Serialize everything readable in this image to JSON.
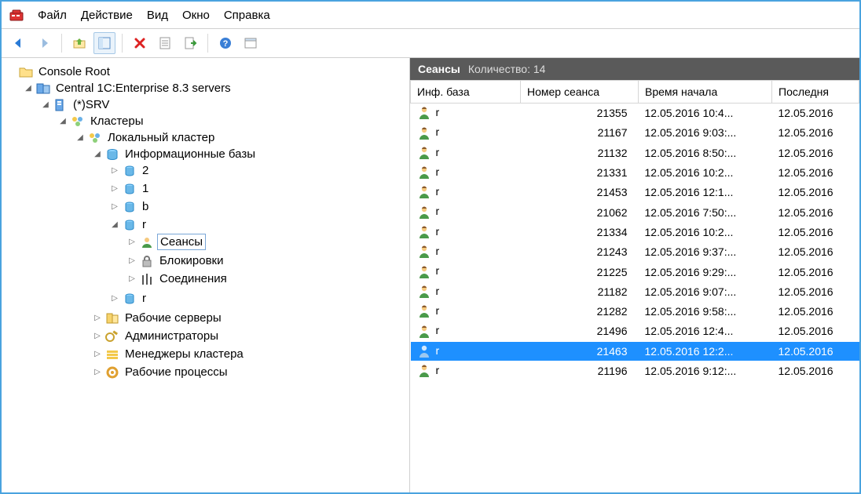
{
  "menu": {
    "items": [
      "Файл",
      "Действие",
      "Вид",
      "Окно",
      "Справка"
    ]
  },
  "tree": {
    "root": "Console Root",
    "servers": "Central 1C:Enterprise 8.3 servers",
    "srv": "(*)SRV",
    "clusters": "Кластеры",
    "local_cluster": "Локальный кластер",
    "infobases": "Информационные базы",
    "ib": [
      "2",
      "1",
      "b",
      "r",
      "r"
    ],
    "ib_r_children": {
      "sessions": "Сеансы",
      "locks": "Блокировки",
      "connections": "Соединения"
    },
    "work_servers": "Рабочие серверы",
    "admins": "Администраторы",
    "cluster_mgrs": "Менеджеры кластера",
    "work_procs": "Рабочие процессы"
  },
  "list": {
    "title": "Сеансы",
    "count_label": "Количество: 14",
    "columns": [
      "Инф. база",
      "Номер сеанса",
      "Время начала",
      "Последня"
    ],
    "rows": [
      {
        "ib": "r",
        "num": "21355",
        "start": "12.05.2016 10:4...",
        "last": "12.05.2016",
        "sel": false
      },
      {
        "ib": "r",
        "num": "21167",
        "start": "12.05.2016 9:03:...",
        "last": "12.05.2016",
        "sel": false
      },
      {
        "ib": "r",
        "num": "21132",
        "start": "12.05.2016 8:50:...",
        "last": "12.05.2016",
        "sel": false
      },
      {
        "ib": "r",
        "num": "21331",
        "start": "12.05.2016 10:2...",
        "last": "12.05.2016",
        "sel": false
      },
      {
        "ib": "r",
        "num": "21453",
        "start": "12.05.2016 12:1...",
        "last": "12.05.2016",
        "sel": false
      },
      {
        "ib": "r",
        "num": "21062",
        "start": "12.05.2016 7:50:...",
        "last": "12.05.2016",
        "sel": false
      },
      {
        "ib": "r",
        "num": "21334",
        "start": "12.05.2016 10:2...",
        "last": "12.05.2016",
        "sel": false
      },
      {
        "ib": "r",
        "num": "21243",
        "start": "12.05.2016 9:37:...",
        "last": "12.05.2016",
        "sel": false
      },
      {
        "ib": "r",
        "num": "21225",
        "start": "12.05.2016 9:29:...",
        "last": "12.05.2016",
        "sel": false
      },
      {
        "ib": "r",
        "num": "21182",
        "start": "12.05.2016 9:07:...",
        "last": "12.05.2016",
        "sel": false
      },
      {
        "ib": "r",
        "num": "21282",
        "start": "12.05.2016 9:58:...",
        "last": "12.05.2016",
        "sel": false
      },
      {
        "ib": "r",
        "num": "21496",
        "start": "12.05.2016 12:4...",
        "last": "12.05.2016",
        "sel": false
      },
      {
        "ib": "r",
        "num": "21463",
        "start": "12.05.2016 12:2...",
        "last": "12.05.2016",
        "sel": true
      },
      {
        "ib": "r",
        "num": "21196",
        "start": "12.05.2016 9:12:...",
        "last": "12.05.2016",
        "sel": false
      }
    ]
  }
}
